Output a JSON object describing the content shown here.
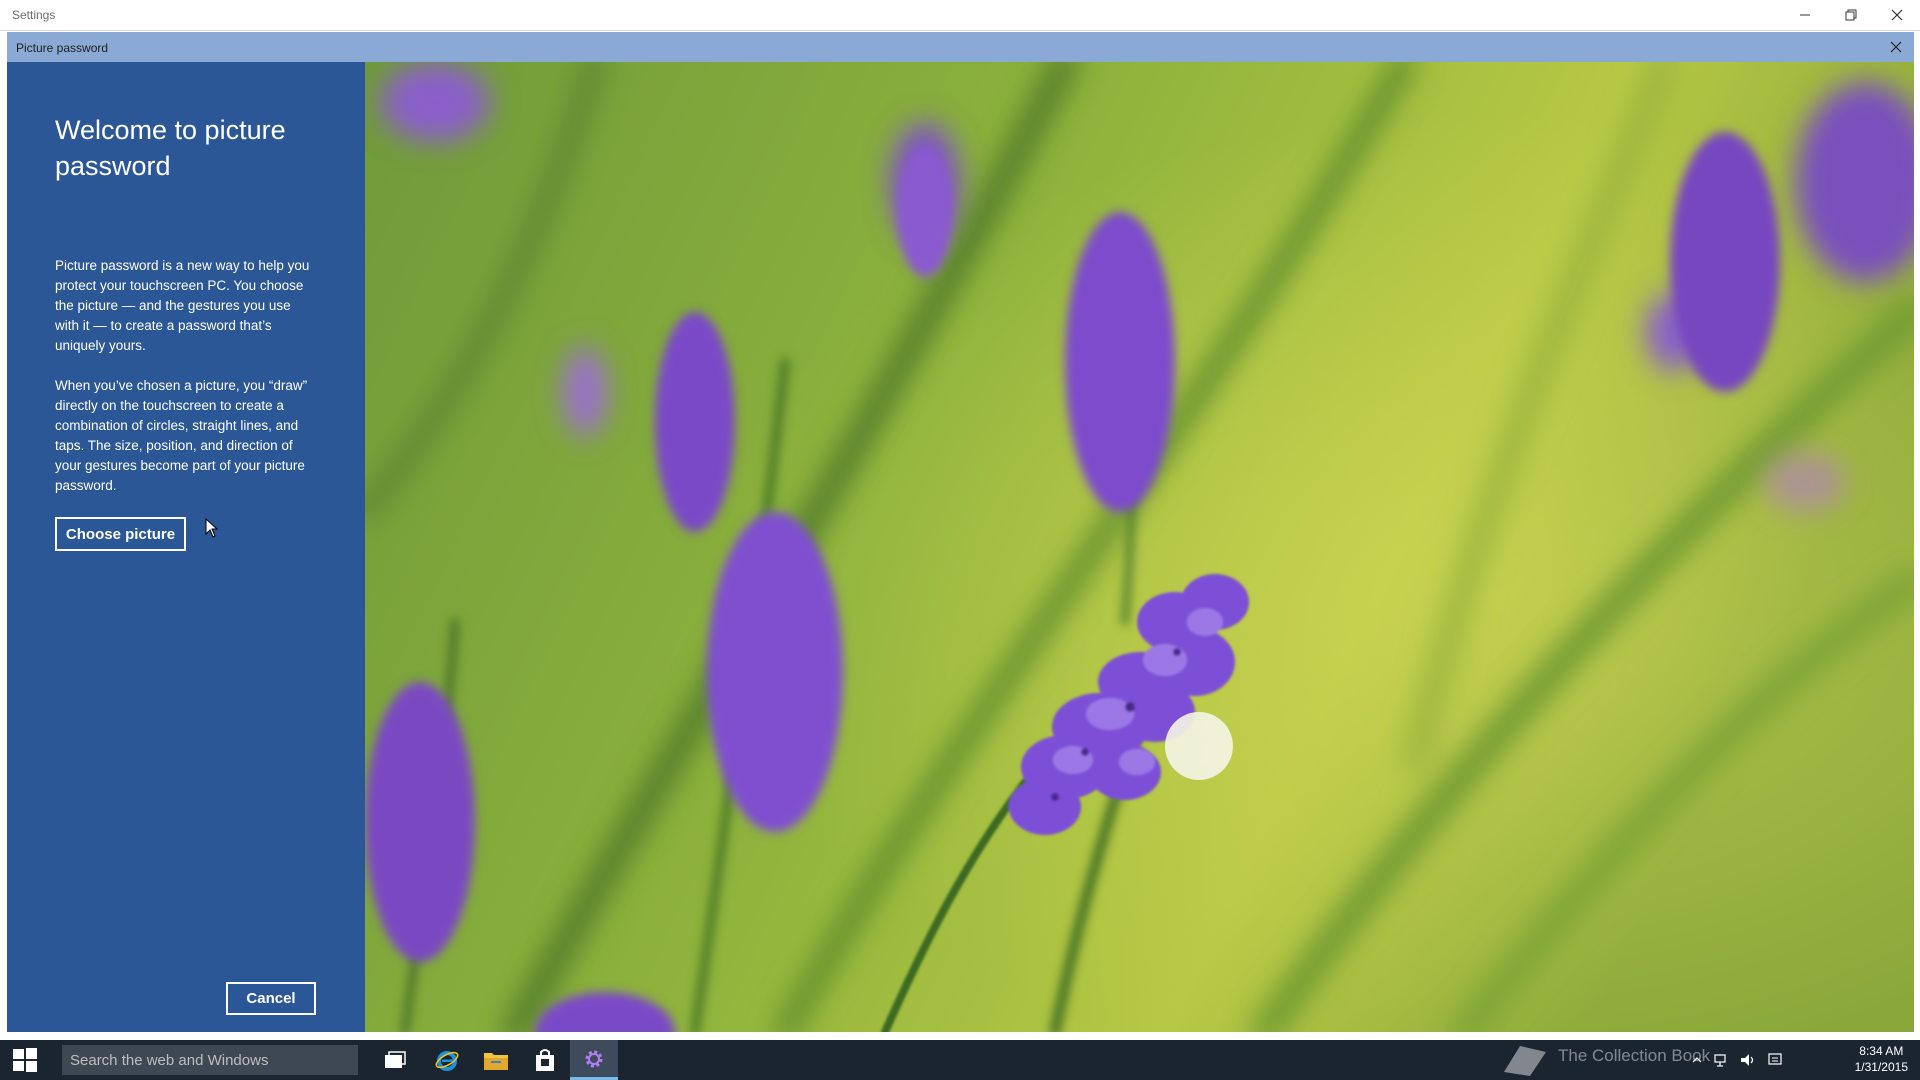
{
  "window": {
    "title": "Settings"
  },
  "dialog": {
    "title": "Picture password",
    "heading": "Welcome to picture password",
    "paragraph1": "Picture password is a new way to help you protect your touchscreen PC. You choose the picture — and the gestures you use with it — to create a password that’s uniquely yours.",
    "paragraph2": "When you’ve chosen a picture, you “draw” directly on the touchscreen to create a combination of circles, straight lines, and taps. The size, position, and direction of your gestures become part of your picture password.",
    "choose_button": "Choose picture",
    "cancel_button": "Cancel"
  },
  "taskbar": {
    "search_placeholder": "Search the web and Windows",
    "watermark": "The Collection Book",
    "time": "8:34 AM",
    "date": "1/31/2015"
  },
  "colors": {
    "panel_blue": "#2b5797",
    "dialog_header": "#8aa9d5",
    "taskbar": "#1b2530"
  }
}
